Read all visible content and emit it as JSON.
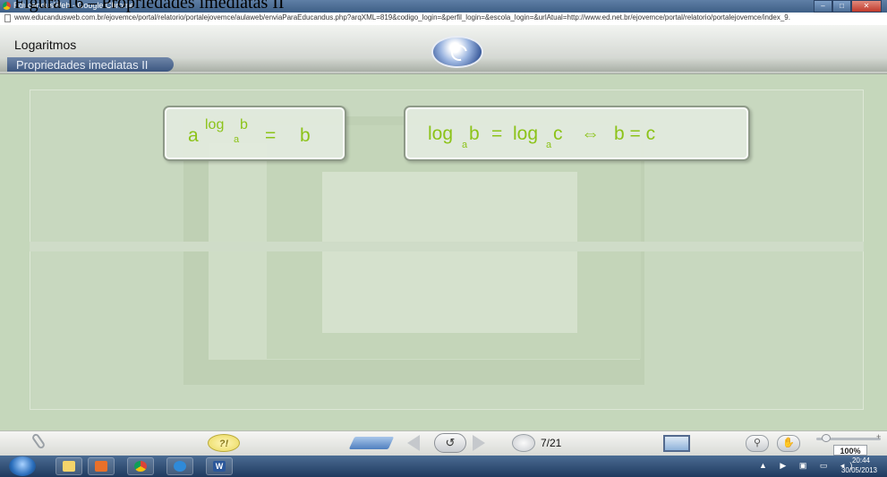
{
  "figure_caption": "Figura 16 – Propriedades imediatas II",
  "browser": {
    "window_title": "EducandusWeb - Google Chrome",
    "url": "www.educandusweb.com.br/ejovemce/portal/relatorio/portalejovemce/aulaweb/enviaParaEducandus.php?arqXML=819&codigo_login=&perfil_login=&escola_login=&urlAtual=http://www.ed.net.br/ejovemce/portal/relatorio/portalejovemce/index_9."
  },
  "app": {
    "subject": "Logaritmos",
    "topic": "Propriedades imediatas II",
    "logo_icon": "educandus-logo-icon"
  },
  "formula1": {
    "base": "a",
    "log": "log",
    "sub": "a",
    "arg": "b",
    "eq": "=",
    "rhs": "b"
  },
  "formula2": {
    "log1": "log",
    "sub1": "a",
    "arg1": "b",
    "eq1": "=",
    "log2": "log",
    "sub2": "a",
    "arg2": "c",
    "iff": "⇔",
    "rhs": "b = c"
  },
  "toolbar": {
    "help_label": "?!",
    "reload_symbol": "↺",
    "page_counter": "7/21",
    "zoom_level": "100%",
    "zoom_plus": "+",
    "icons": [
      "clip-icon",
      "help-icon",
      "calculator-icon",
      "prev-icon",
      "reload-icon",
      "next-icon",
      "pages-icon",
      "fullscreen-icon",
      "zoom-icon",
      "hand-icon"
    ]
  },
  "taskbar": {
    "word_glyph": "W",
    "tray": "▲ ▶ ▣ ▭ ◂)",
    "time": "20:44",
    "date": "30/05/2013"
  },
  "colors": {
    "formula_green": "#8cc319",
    "stage_bg": "#c5d7bb",
    "topic_pill": "#3c5680"
  }
}
